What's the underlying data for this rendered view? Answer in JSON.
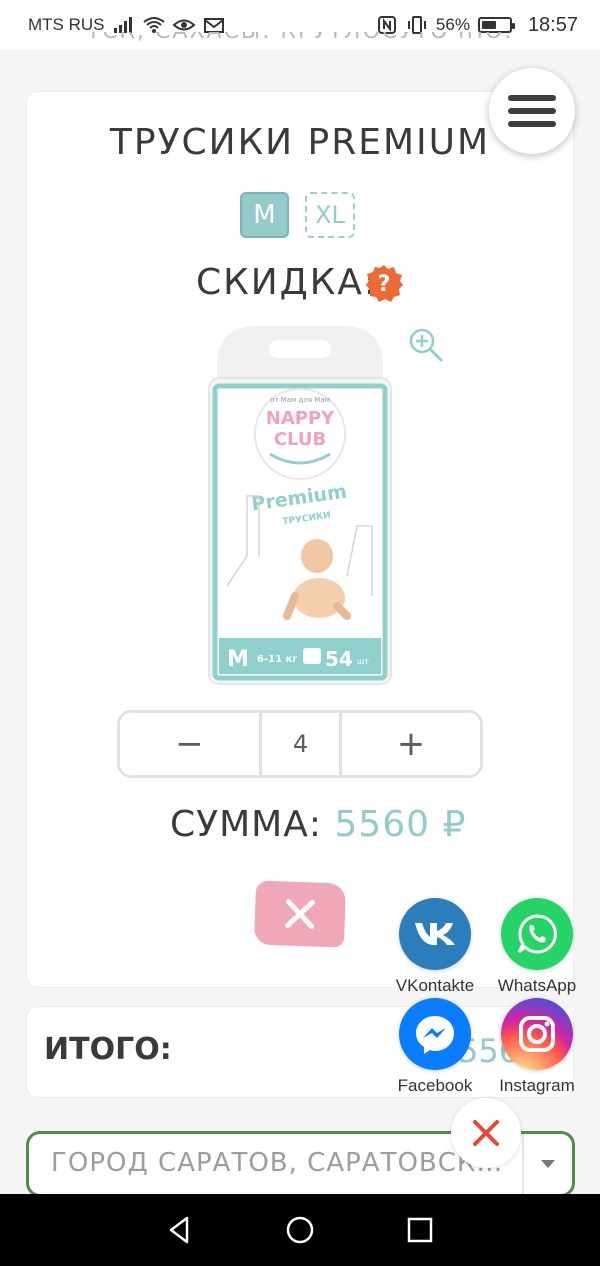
{
  "status_bar": {
    "carrier": "MTS RUS",
    "battery_percent": "56%",
    "battery_level": 0.56,
    "time": "18:57",
    "icons": [
      "signal-icon",
      "wifi-icon",
      "eye-icon",
      "mail-icon",
      "nfc-icon",
      "vibrate-icon",
      "battery-icon"
    ]
  },
  "header": {
    "scrolled_text": "ТСК, САХАСЫ. КРУТЛОСУТОЧНО."
  },
  "product": {
    "title": "ТРУСИКИ PREMIUM",
    "sizes": [
      {
        "label": "M",
        "selected": true
      },
      {
        "label": "XL",
        "selected": false
      }
    ],
    "discount_label": "СКИДКА:",
    "help_icon": "question-icon",
    "zoom_icon": "zoom-in-icon",
    "package": {
      "brand_top": "от Мам для Мам",
      "brand": "NAPPY CLUB",
      "line": "Premium",
      "type": "трусики",
      "size": "M",
      "weight": "6-11 кг",
      "count": "54 шт"
    },
    "quantity": {
      "minus_label": "−",
      "value": "4",
      "plus_label": "+"
    },
    "sum_label": "СУММА:",
    "sum_value": "5560 ₽",
    "remove_icon": "close-icon"
  },
  "total": {
    "label": "ИТОГО:",
    "value": "556"
  },
  "address": {
    "value": "ГОРОД САРАТОВ, САРАТОВСКАЯ О..."
  },
  "share": {
    "items": [
      {
        "name": "VKontakte",
        "color": "#2c7dbb"
      },
      {
        "name": "WhatsApp",
        "color": "#25d366"
      },
      {
        "name": "Facebook",
        "color": "#0a7cff"
      },
      {
        "name": "Instagram",
        "color": "#d6249f"
      }
    ],
    "close_color": "#e8482f"
  },
  "colors": {
    "accent": "#92cbc9",
    "help_badge": "#ec6a35",
    "remove_button": "#f0a7b8",
    "address_border": "#4c8f45"
  }
}
